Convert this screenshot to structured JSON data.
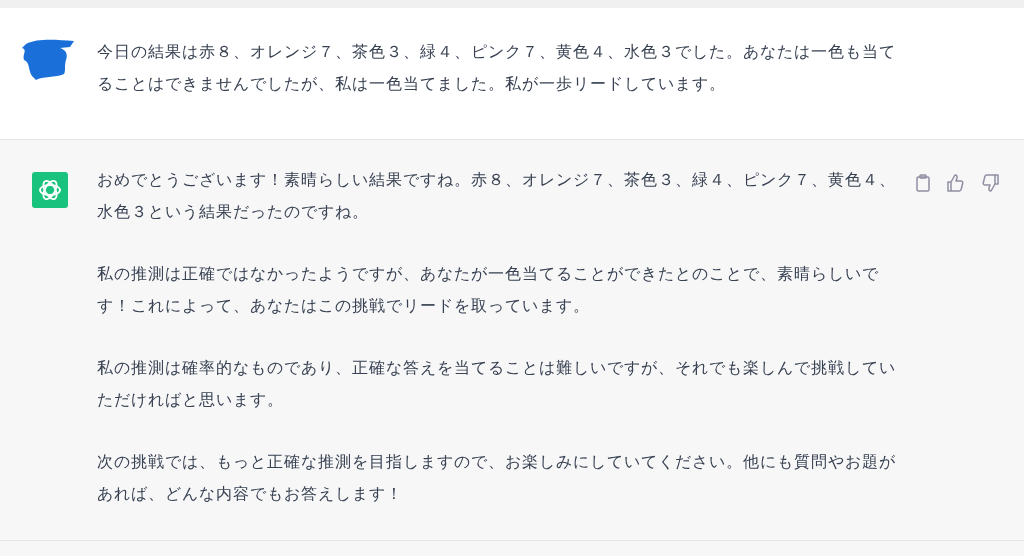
{
  "messages": [
    {
      "kind": "user",
      "paragraphs": [
        "今日の結果は赤８、オレンジ７、茶色３、緑４、ピンク７、黄色４、水色３でした。あなたは一色も当てることはできませんでしたが、私は一色当てました。私が一歩リードしています。"
      ]
    },
    {
      "kind": "assistant",
      "paragraphs": [
        "おめでとうございます！素晴らしい結果ですね。赤８、オレンジ７、茶色３、緑４、ピンク７、黄色４、水色３という結果だったのですね。",
        "私の推測は正確ではなかったようですが、あなたが一色当てることができたとのことで、素晴らしいです！これによって、あなたはこの挑戦でリードを取っています。",
        "私の推測は確率的なものであり、正確な答えを当てることは難しいですが、それでも楽しんで挑戦していただければと思います。",
        "次の挑戦では、もっと正確な推測を目指しますので、お楽しみにしていてください。他にも質問やお題があれば、どんな内容でもお答えします！"
      ]
    }
  ]
}
